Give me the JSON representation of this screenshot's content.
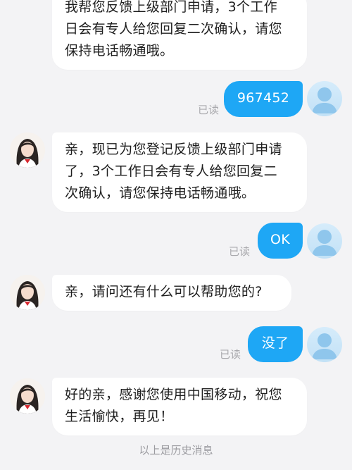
{
  "messages": [
    {
      "sender": "agent",
      "lines": [
        "我帮您反馈上级部门申请，3个工作",
        "日会有专人给您回复二次确认，请您",
        "保持电话畅通哦。"
      ]
    },
    {
      "sender": "user",
      "text": "967452",
      "status": "已读"
    },
    {
      "sender": "agent",
      "lines": [
        "亲，现已为您登记反馈上级部门申请",
        "了，3个工作日会有专人给您回复二",
        "次确认，请您保持电话畅通哦。"
      ]
    },
    {
      "sender": "user",
      "text": "OK",
      "status": "已读"
    },
    {
      "sender": "agent",
      "lines": [
        "亲，请问还有什么可以帮助您的?"
      ]
    },
    {
      "sender": "user",
      "text": "没了",
      "status": "已读"
    },
    {
      "sender": "agent",
      "lines": [
        "好的亲，感谢您使用中国移动，祝您",
        "生活愉快，再见！"
      ]
    }
  ],
  "footer_text": "以上是历史消息",
  "colors": {
    "user_bubble": "#1ea7f5",
    "agent_bubble": "#ffffff",
    "background": "#f3f3f5",
    "read_status": "#a9a9ad"
  },
  "icons": {
    "agent_avatar": "agent-portrait-icon",
    "user_avatar": "default-user-silhouette-icon"
  }
}
